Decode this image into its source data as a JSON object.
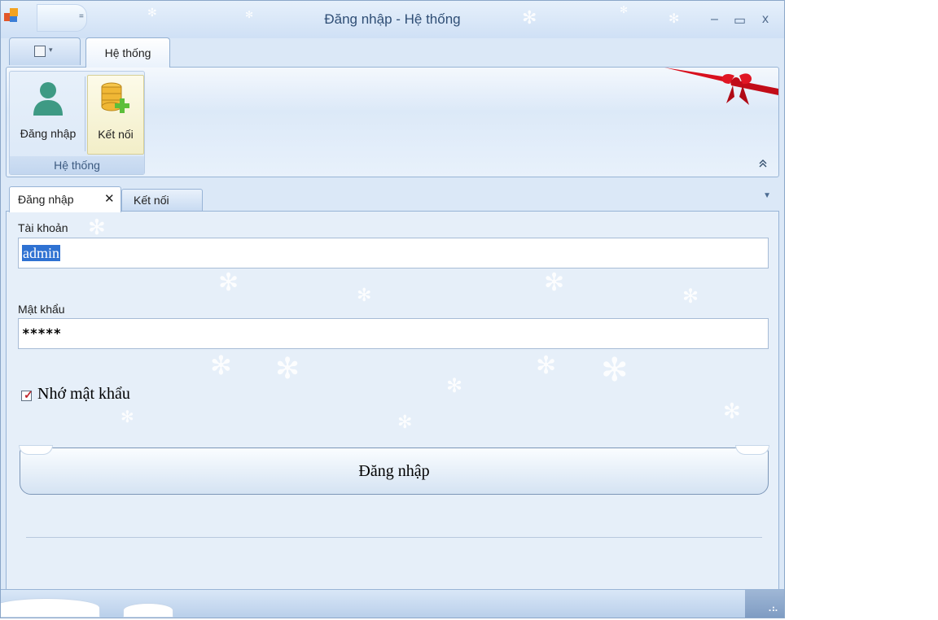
{
  "window": {
    "title": "Đăng nhập - Hệ thống",
    "minimize": "–",
    "maximize": "▭",
    "close": "x"
  },
  "qat": {
    "dropdown": "="
  },
  "ribbon": {
    "active_tab": "Hệ thống",
    "group": {
      "caption": "Hệ thống",
      "buttons": [
        {
          "label": "Đăng nhập",
          "icon": "user-icon"
        },
        {
          "label": "Kết nối",
          "icon": "database-add-icon"
        }
      ]
    },
    "collapse_glyph": "«"
  },
  "doc_tabs": [
    {
      "label": "Đăng nhập",
      "active": true,
      "close": "✕"
    },
    {
      "label": "Kết nối",
      "active": false
    }
  ],
  "form": {
    "username_label": "Tài khoản",
    "username_value": "admin",
    "password_label": "Mật khẩu",
    "password_value": "*****",
    "remember_label": "Nhớ mật khẩu",
    "remember_checked": true,
    "login_button": "Đăng nhập"
  },
  "colors": {
    "accent": "#2f72d2",
    "ribbon_bow": "#d8101e"
  }
}
